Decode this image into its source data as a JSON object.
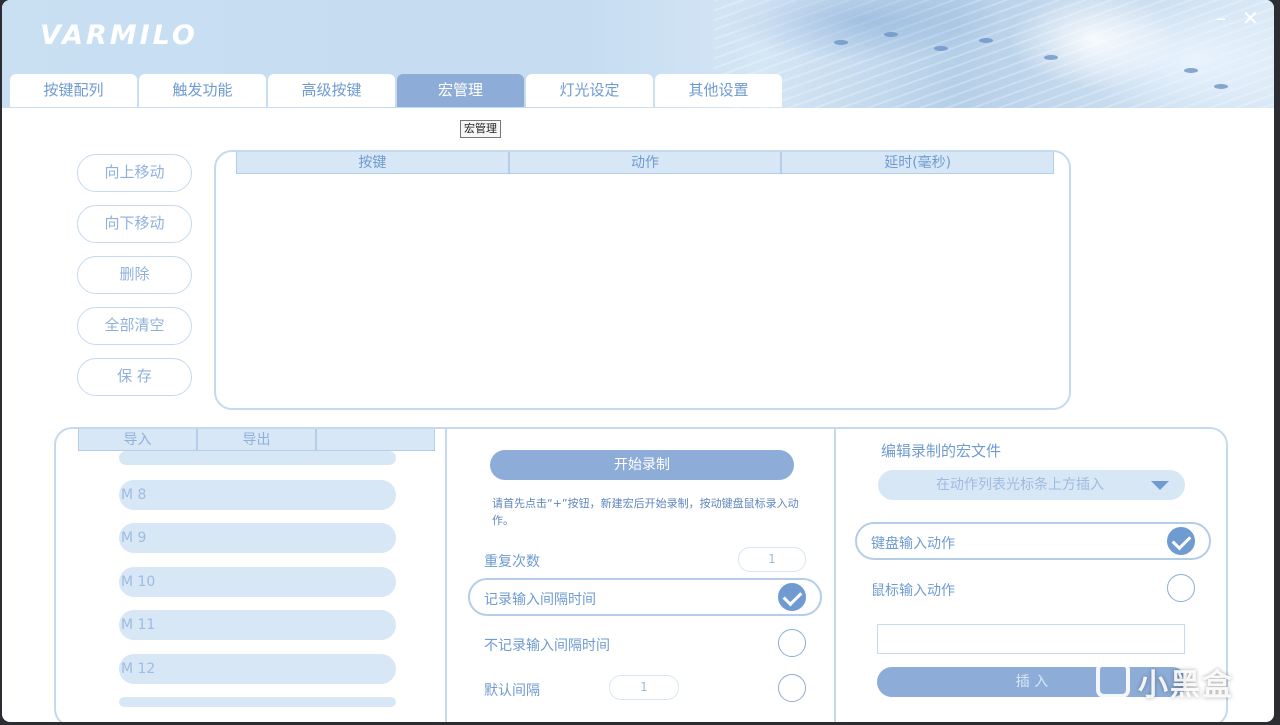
{
  "app": {
    "logo": "VARMILO",
    "minimize": "–",
    "close": "✕"
  },
  "tabs": [
    {
      "label": "按键配列"
    },
    {
      "label": "触发功能"
    },
    {
      "label": "高级按键"
    },
    {
      "label": "宏管理"
    },
    {
      "label": "灯光设定"
    },
    {
      "label": "其他设置"
    }
  ],
  "active_tab": "宏管理",
  "tooltip": "宏管理",
  "side_buttons": {
    "move_up": "向上移动",
    "move_down": "向下移动",
    "delete": "删除",
    "clear_all": "全部清空",
    "save": "保 存"
  },
  "macro_table": {
    "columns": [
      "按键",
      "动作",
      "延时(毫秒)"
    ],
    "rows": []
  },
  "macro_list": {
    "tabs": [
      "导入",
      "导出",
      ""
    ],
    "items": [
      "M 8",
      "M 9",
      "M 10",
      "M 11",
      "M 12"
    ]
  },
  "recording": {
    "start_button": "开始录制",
    "hint": "请首先点击“+”按钮，新建宏后开始录制，按动键盘鼠标录入动作。",
    "repeat_label": "重复次数",
    "repeat_value": "1",
    "options": [
      {
        "label": "记录输入间隔时间",
        "checked": true
      },
      {
        "label": "不记录输入间隔时间",
        "checked": false
      },
      {
        "label": "默认间隔",
        "checked": false
      }
    ],
    "default_interval_value": "1"
  },
  "editor": {
    "title": "编辑录制的宏文件",
    "insert_mode": "在动作列表光标条上方插入",
    "options": [
      {
        "label": "键盘输入动作",
        "checked": true
      },
      {
        "label": "鼠标输入动作",
        "checked": false
      }
    ],
    "input_value": "",
    "insert_button": "插 入"
  },
  "watermark": "小黑盒",
  "colors": {
    "accent": "#6f9bd1",
    "tab_active": "#8dadd8",
    "pale": "#d8e7f6",
    "border": "#c5d9ef"
  }
}
